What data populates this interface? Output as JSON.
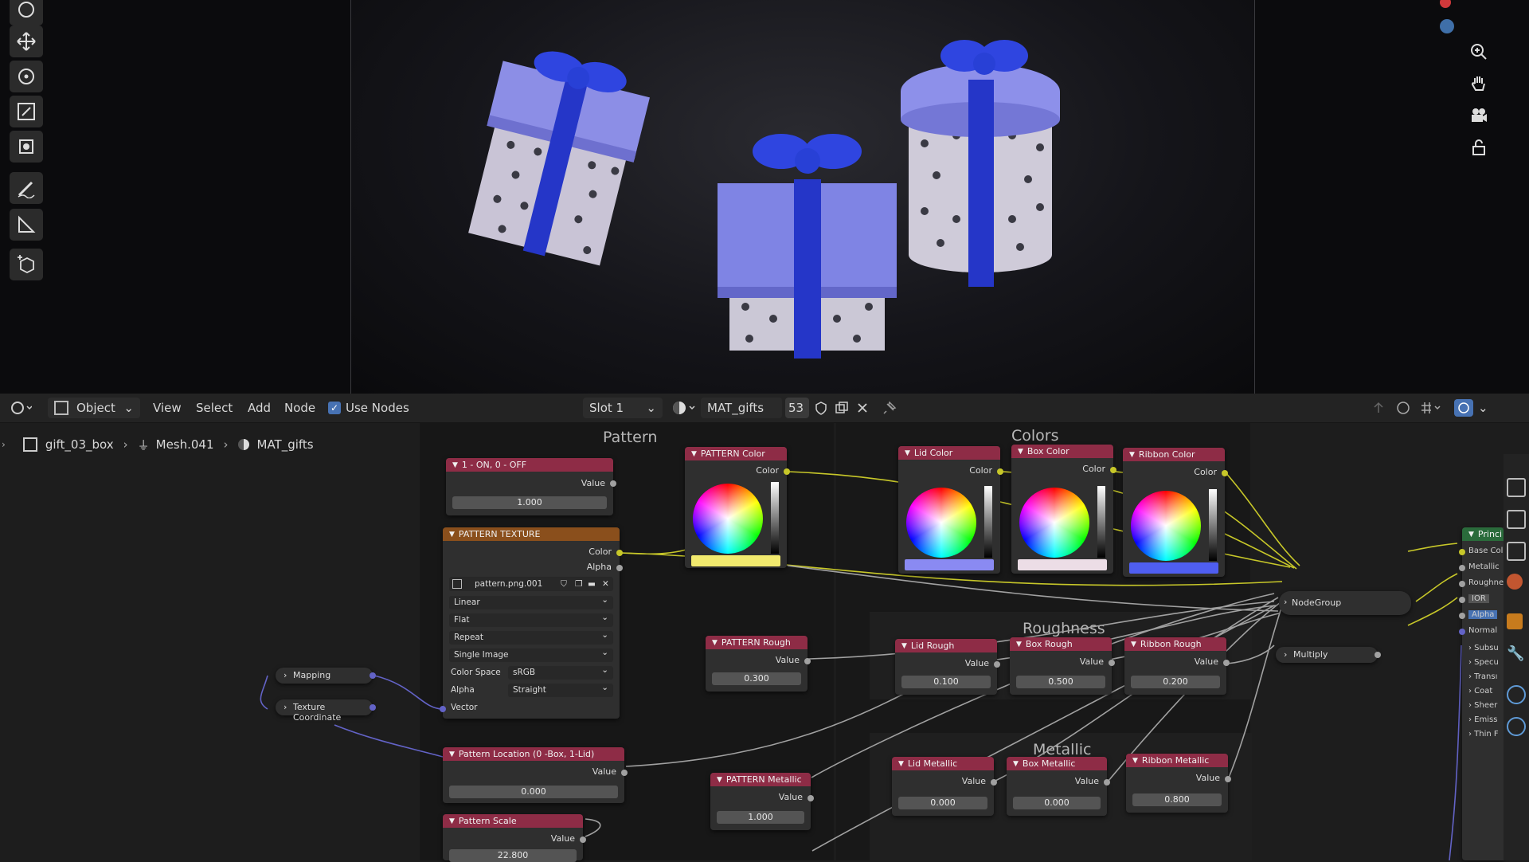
{
  "viewport": {
    "tools": [
      "cursor-icon",
      "move-icon",
      "rotate-icon",
      "scale-icon",
      "transform-icon",
      "annotate-icon",
      "measure-icon",
      "add-cube-icon"
    ],
    "nav": [
      "zoom-icon",
      "pan-hand-icon",
      "camera-icon",
      "lock-icon"
    ]
  },
  "header": {
    "mode": "Object",
    "menus": [
      "View",
      "Select",
      "Add",
      "Node"
    ],
    "use_nodes_label": "Use Nodes",
    "slot": "Slot 1",
    "material": "MAT_gifts",
    "users": "53"
  },
  "breadcrumb": {
    "object": "gift_03_box",
    "mesh": "Mesh.041",
    "material": "MAT_gifts"
  },
  "frames": {
    "pattern": "Pattern",
    "colors": "Colors",
    "roughness": "Roughness",
    "metallic": "Metallic"
  },
  "nodes": {
    "onoff": {
      "title": "1 - ON, 0 - OFF",
      "out": "Value",
      "value": "1.000"
    },
    "pattern_texture": {
      "title": "PATTERN TEXTURE",
      "out_color": "Color",
      "out_alpha": "Alpha",
      "image": "pattern.png.001",
      "interpolation": "Linear",
      "projection": "Flat",
      "extension": "Repeat",
      "source": "Single Image",
      "colorspace_label": "Color Space",
      "colorspace": "sRGB",
      "alpha_label": "Alpha",
      "alpha": "Straight",
      "vector_label": "Vector"
    },
    "pattern_color": {
      "title": "PATTERN Color",
      "out": "Color",
      "swatch": "#f2ea6e"
    },
    "lid_color": {
      "title": "Lid Color",
      "out": "Color",
      "swatch": "#8a8af2"
    },
    "box_color": {
      "title": "Box Color",
      "out": "Color",
      "swatch": "#ecdde6"
    },
    "ribbon_color": {
      "title": "Ribbon Color",
      "out": "Color",
      "swatch": "#4f5ef0"
    },
    "pattern_rough": {
      "title": "PATTERN Rough",
      "out": "Value",
      "value": "0.300"
    },
    "lid_rough": {
      "title": "Lid Rough",
      "out": "Value",
      "value": "0.100"
    },
    "box_rough": {
      "title": "Box Rough",
      "out": "Value",
      "value": "0.500"
    },
    "ribbon_rough": {
      "title": "Ribbon Rough",
      "out": "Value",
      "value": "0.200"
    },
    "pattern_metallic": {
      "title": "PATTERN Metallic",
      "out": "Value",
      "value": "1.000"
    },
    "lid_metallic": {
      "title": "Lid Metallic",
      "out": "Value",
      "value": "0.000"
    },
    "box_metallic": {
      "title": "Box Metallic",
      "out": "Value",
      "value": "0.000"
    },
    "ribbon_metallic": {
      "title": "Ribbon Metallic",
      "out": "Value",
      "value": "0.800"
    },
    "pattern_location": {
      "title": "Pattern Location (0 -Box, 1-Lid)",
      "out": "Value",
      "value": "0.000"
    },
    "pattern_scale": {
      "title": "Pattern Scale",
      "out": "Value",
      "value": "22.800"
    },
    "mapping": {
      "title": "Mapping"
    },
    "texcoord": {
      "title": "Texture Coordinate"
    },
    "nodegroup": {
      "title": "NodeGroup"
    },
    "multiply": {
      "title": "Multiply"
    },
    "principled": {
      "title": "Princi",
      "inputs": [
        "Base Col",
        "Metallic",
        "Roughne",
        "IOR",
        "Alpha",
        "Normal"
      ],
      "panels": [
        "Subsu",
        "Specu",
        "Transı",
        "Coat",
        "Sheer",
        "Emiss",
        "Thin F"
      ]
    }
  }
}
